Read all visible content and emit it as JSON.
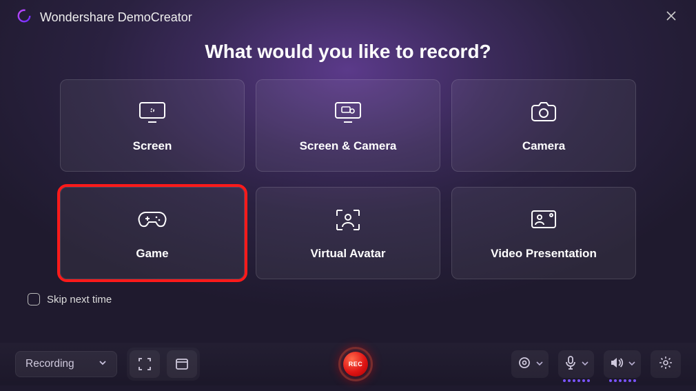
{
  "app": {
    "title": "Wondershare DemoCreator"
  },
  "heading": "What would you like to record?",
  "cards": [
    {
      "label": "Screen"
    },
    {
      "label": "Screen & Camera"
    },
    {
      "label": "Camera"
    },
    {
      "label": "Game"
    },
    {
      "label": "Virtual Avatar"
    },
    {
      "label": "Video Presentation"
    }
  ],
  "skip": {
    "label": "Skip next time",
    "checked": false
  },
  "bottombar": {
    "mode": "Recording",
    "rec_label": "REC"
  }
}
